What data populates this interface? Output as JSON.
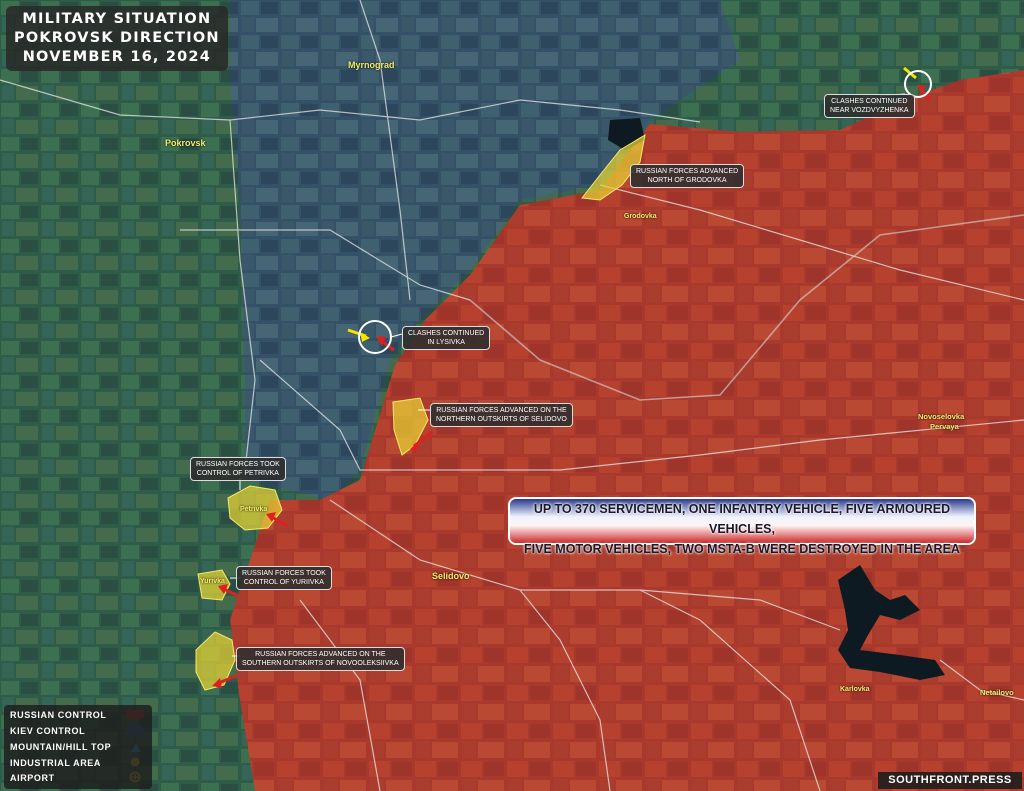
{
  "title": {
    "line1": "MILITARY SITUATION",
    "line2": "POKROVSK DIRECTION",
    "line3": "NOVEMBER 16, 2024"
  },
  "colors": {
    "russian_control": "#b23a2e",
    "kiev_control": "#2f6fa8",
    "advance": "#e8d234",
    "arrow_red": "#e02020",
    "arrow_yellow": "#f5e400"
  },
  "callouts": {
    "vozdvyzhenka": [
      "CLASHES CONTINUED",
      "NEAR VOZDVYZHENKA"
    ],
    "grodovka": [
      "RUSSIAN FORCES ADVANCED",
      "NORTH OF GRODOVKA"
    ],
    "lysivka": [
      "CLASHES CONTINUED",
      "IN LYSIVKA"
    ],
    "selidovo": [
      "RUSSIAN FORCES ADVANCED ON THE",
      "NORTHERN OUTSKIRTS OF SELIDOVO"
    ],
    "petrivka": [
      "RUSSIAN FORCES TOOK",
      "CONTROL OF PETRIVKA"
    ],
    "yuriivka": [
      "RUSSIAN FORCES TOOK",
      "CONTROL OF YURIIVKA"
    ],
    "novooleksiivka": [
      "RUSSIAN FORCES ADVANCED ON THE",
      "SOUTHERN OUTSKIRTS OF NOVOOLEKSIIVKA"
    ]
  },
  "losses": {
    "line1": "UP TO 370 SERVICEMEN, ONE INFANTRY VEHICLE, FIVE ARMOURED VEHICLES,",
    "line2": "FIVE MOTOR VEHICLES, TWO MSTA-B WERE DESTROYED IN THE AREA"
  },
  "towns": {
    "pokrovsk": "Pokrovsk",
    "myrnograd": "Myrnograd",
    "selidovo": "Selidovo",
    "grodovka": "Grodovka",
    "petrivka": "Petrivka",
    "yuriivka": "Yurivka",
    "novoselovka": [
      "Novoselovka",
      "Pervaya"
    ],
    "karlovka": "Karlovka",
    "netailovo": "Netailovo"
  },
  "legend": {
    "russian": "RUSSIAN CONTROL",
    "kiev": "KIEV CONTROL",
    "mountain": "MOUNTAIN/HILL TOP",
    "industrial": "INDUSTRIAL AREA",
    "airport": "AIRPORT"
  },
  "brand": "SOUTHFRONT.PRESS"
}
